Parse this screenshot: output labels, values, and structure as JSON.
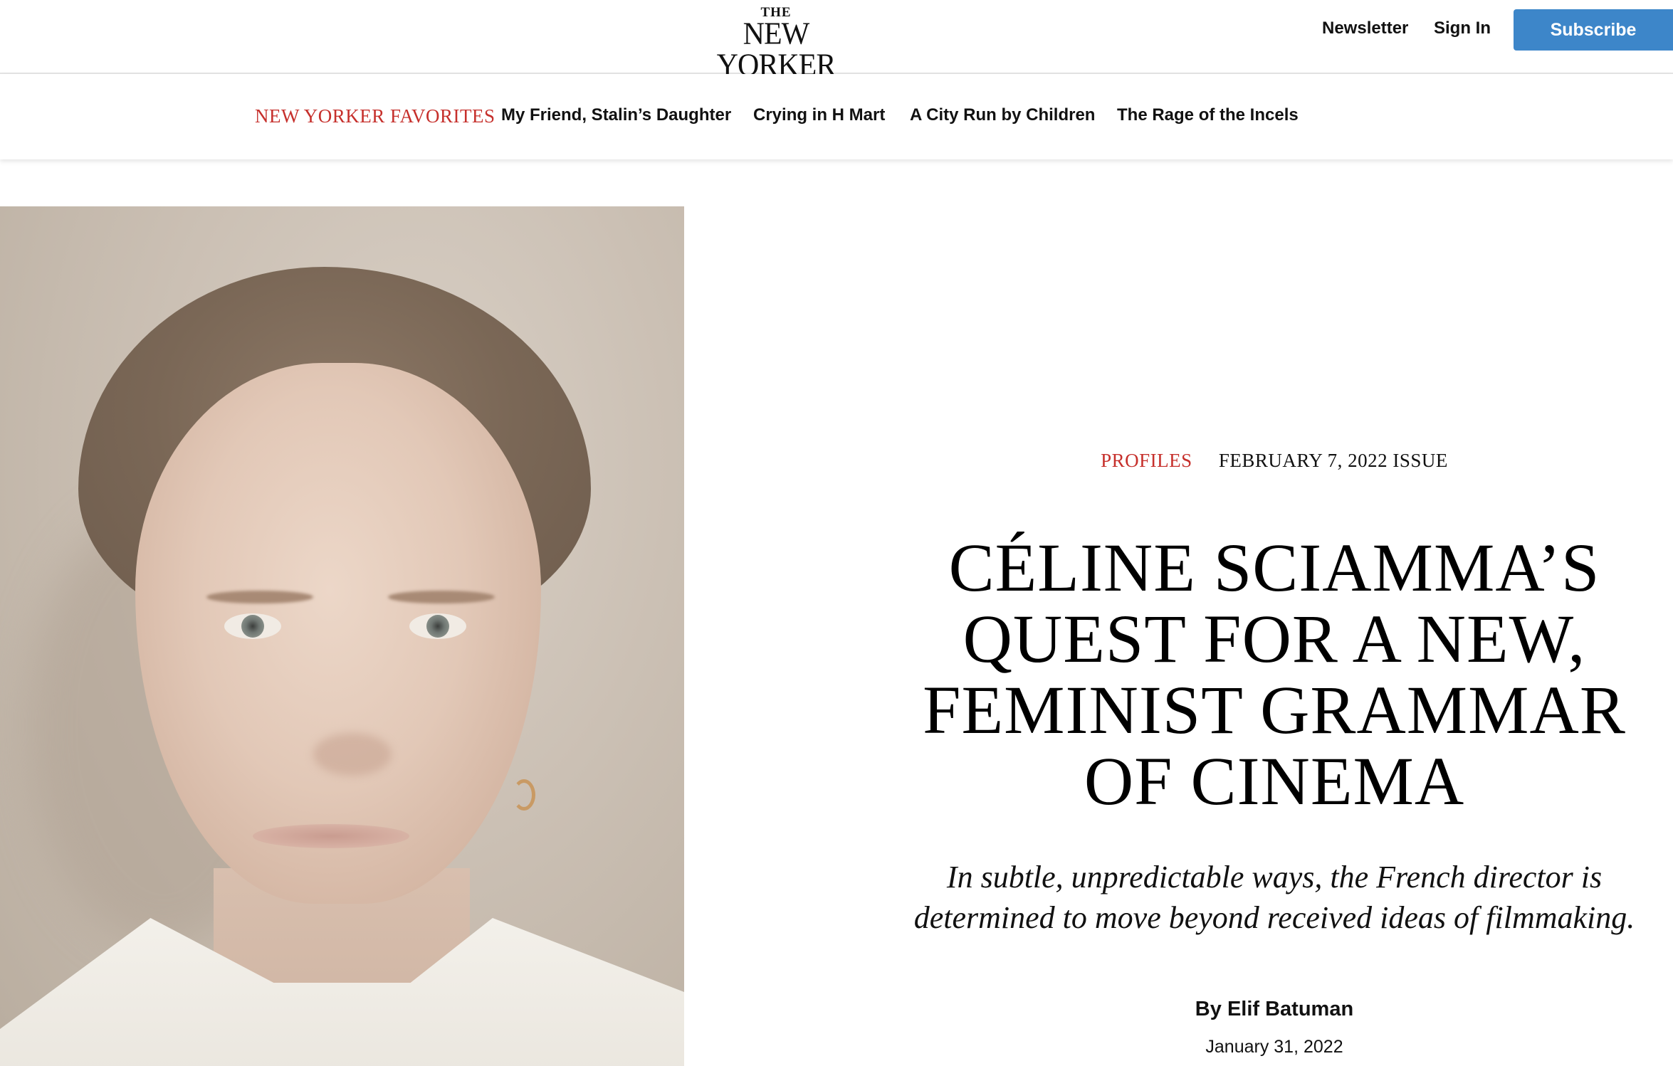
{
  "header": {
    "logo_the": "THE",
    "logo_main": "NEW YORKER",
    "newsletter": "Newsletter",
    "sign_in": "Sign In",
    "subscribe": "Subscribe"
  },
  "nav": {
    "favorites_label": "NEW YORKER FAVORITES",
    "items": [
      "My Friend, Stalin’s Daughter",
      "Crying in H Mart",
      "A City Run by Children",
      "The Rage of the Incels"
    ]
  },
  "article": {
    "rubric": "PROFILES",
    "issue": "FEBRUARY 7, 2022 ISSUE",
    "headline": "CÉLINE SCIAMMA’S QUEST FOR A NEW, FEMINIST GRAMMAR OF CINEMA",
    "dek": "In subtle, unpredictable ways, the French director is determined to move beyond received ideas of filmmaking.",
    "byline_prefix": "By ",
    "author": "Elif Batuman",
    "date": "January 31, 2022"
  },
  "colors": {
    "accent_red": "#c6302c",
    "subscribe_blue": "#3d86c9"
  }
}
